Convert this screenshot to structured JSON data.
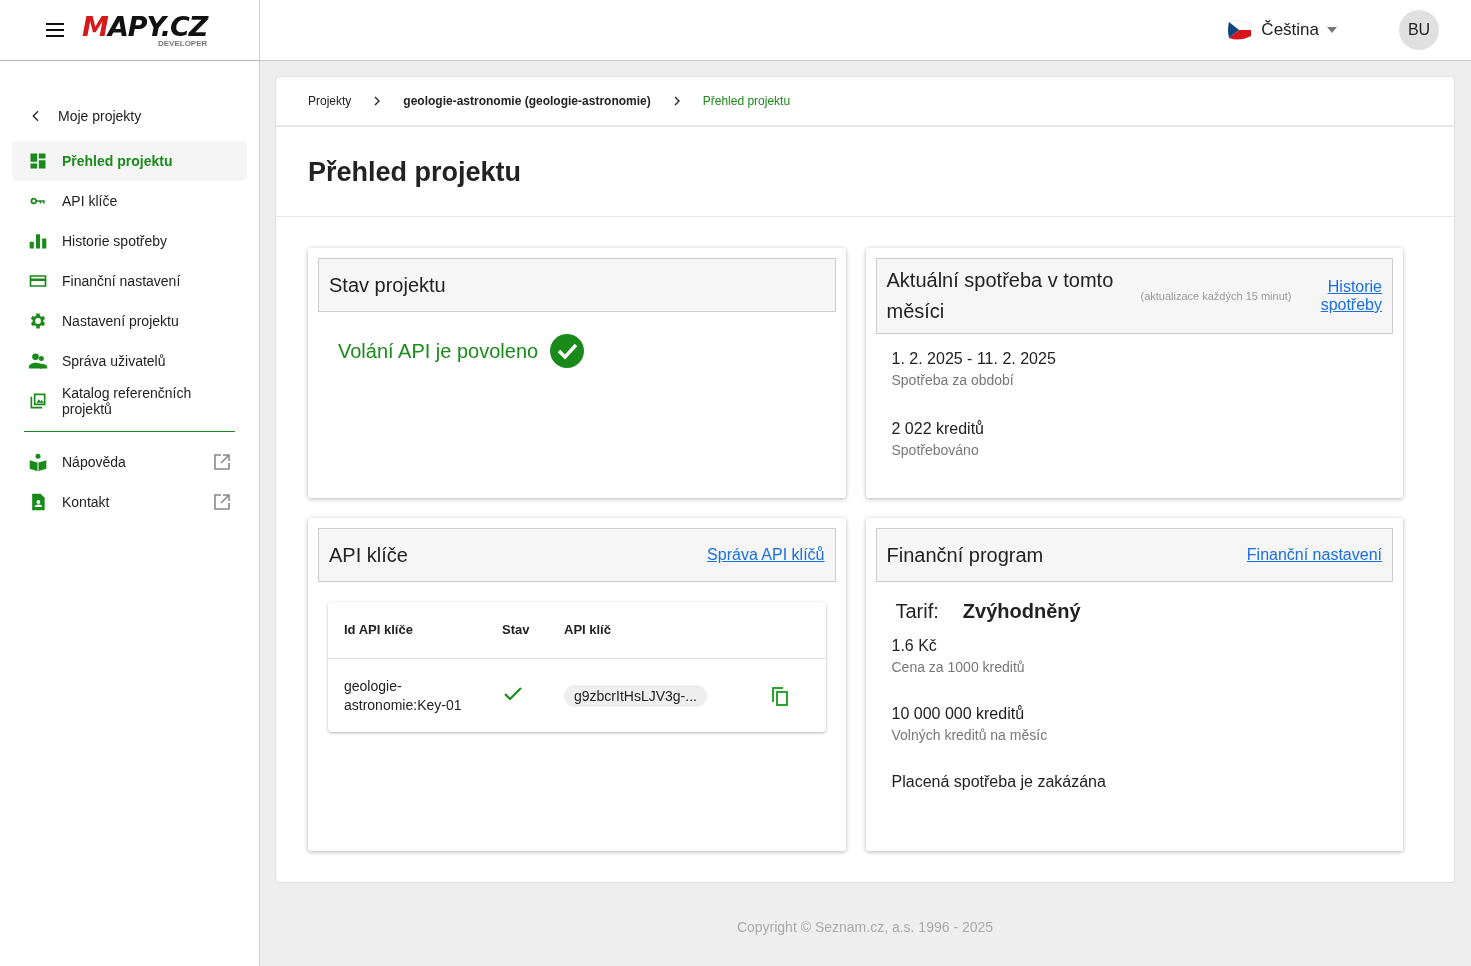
{
  "header": {
    "logo": "MAPY.CZ",
    "logo_sub": "DEVELOPER",
    "language": "Čeština",
    "avatar": "BU"
  },
  "sidebar": {
    "back": "Moje projekty",
    "items": [
      {
        "label": "Přehled projektu",
        "selected": true
      },
      {
        "label": "API klíče",
        "selected": false
      },
      {
        "label": "Historie spotřeby",
        "selected": false
      },
      {
        "label": "Finanční nastavení",
        "selected": false
      },
      {
        "label": "Nastavení projektu",
        "selected": false
      },
      {
        "label": "Správa uživatelů",
        "selected": false
      },
      {
        "label": "Katalog referenčních projektů",
        "selected": false
      }
    ],
    "external_items": [
      {
        "label": "Nápověda"
      },
      {
        "label": "Kontakt"
      }
    ]
  },
  "breadcrumb": [
    "Projekty",
    "geologie-astronomie (geologie-astronomie)",
    "Přehled projektu"
  ],
  "page_title": "Přehled projektu",
  "status_card": {
    "title": "Stav projektu",
    "message": "Volání API je povoleno",
    "enabled": true
  },
  "usage_card": {
    "title": "Aktuální spotřeba v tomto měsíci",
    "note": "(aktualizace každých 15 minut)",
    "link": "Historie spotřeby",
    "stats": [
      {
        "value": "1. 2. 2025 - 11. 2. 2025",
        "label": "Spotřeba za období"
      },
      {
        "value": "2 022 kreditů",
        "label": "Spotřebováno"
      }
    ]
  },
  "keys_card": {
    "title": "API klíče",
    "link": "Správa API klíčů",
    "columns": [
      "Id API klíče",
      "Stav",
      "API klíč"
    ],
    "rows": [
      {
        "id": "geologie-astronomie:Key-01",
        "active": true,
        "key": "g9zbcrItHsLJV3g-..."
      }
    ]
  },
  "finance_card": {
    "title": "Finanční program",
    "link": "Finanční nastavení",
    "tariff_label": "Tarif:",
    "tariff": "Zvýhodněný",
    "stats": [
      {
        "value": "1.6 Kč",
        "label": "Cena za 1000 kreditů"
      },
      {
        "value": "10 000 000 kreditů",
        "label": "Volných kreditů na měsíc"
      }
    ],
    "footer_note": "Placená spotřeba je zakázána"
  },
  "copyright": "Copyright © Seznam.cz, a.s. 1996 - 2025"
}
